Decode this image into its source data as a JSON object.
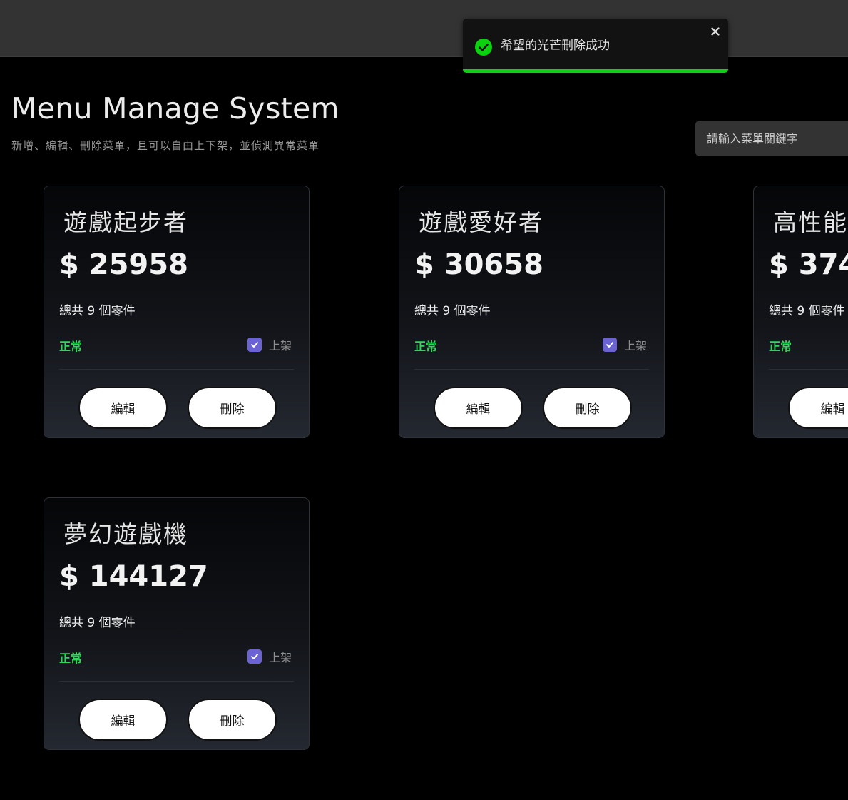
{
  "toast": {
    "message": "希望的光芒刪除成功",
    "icon": "check-circle-icon",
    "close_icon": "close-icon",
    "success_color": "#0bd10f",
    "progress": 1.0
  },
  "header": {
    "title": "Menu Manage System",
    "subtitle": "新增、編輯、刪除菜單，且可以自由上下架，並偵測異常菜單"
  },
  "search": {
    "placeholder": "請輸入菜單關鍵字"
  },
  "cards": [
    {
      "name": "遊戲起步者",
      "price": "$ 25958",
      "parts": "總共 9 個零件",
      "status": "正常",
      "listed": true,
      "listed_label": "上架",
      "edit_label": "編輯",
      "delete_label": "刪除"
    },
    {
      "name": "遊戲愛好者",
      "price": "$ 30658",
      "parts": "總共 9 個零件",
      "status": "正常",
      "listed": true,
      "listed_label": "上架",
      "edit_label": "編輯",
      "delete_label": "刪除"
    },
    {
      "name": "高性能",
      "price": "$ 374",
      "parts": "總共 9 個零件",
      "status": "正常",
      "edit_label": "編輯"
    },
    {
      "name": "夢幻遊戲機",
      "price": "$ 144127",
      "parts": "總共 9 個零件",
      "status": "正常",
      "listed": true,
      "listed_label": "上架",
      "edit_label": "編輯",
      "delete_label": "刪除"
    }
  ],
  "colors": {
    "status_ok": "#2fd65a",
    "checkbox": "#6b63d4",
    "topbar": "#333333"
  }
}
